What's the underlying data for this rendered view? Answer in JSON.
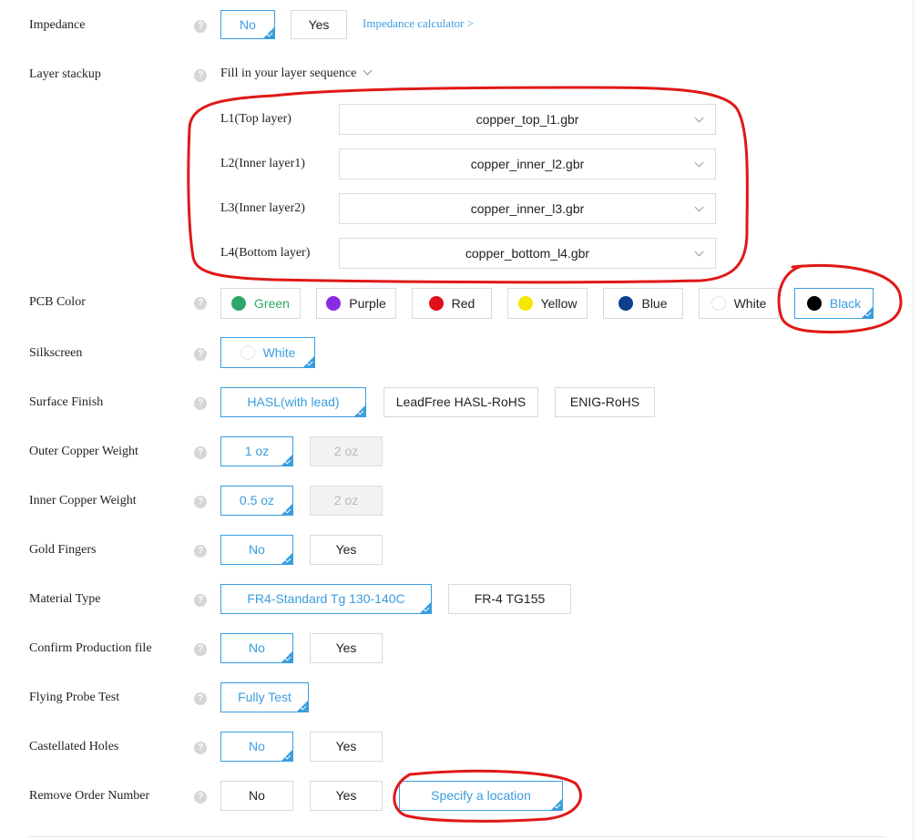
{
  "impedance": {
    "label": "Impedance",
    "options": [
      "No",
      "Yes"
    ],
    "calculator_link": "Impedance calculator >"
  },
  "layer_stackup": {
    "label": "Layer stackup",
    "toggle": "Fill in your layer sequence",
    "layers": [
      {
        "name": "L1(Top layer)",
        "file": "copper_top_l1.gbr"
      },
      {
        "name": "L2(Inner layer1)",
        "file": "copper_inner_l2.gbr"
      },
      {
        "name": "L3(Inner layer2)",
        "file": "copper_inner_l3.gbr"
      },
      {
        "name": "L4(Bottom layer)",
        "file": "copper_bottom_l4.gbr"
      }
    ]
  },
  "pcb_color": {
    "label": "PCB Color",
    "options": [
      {
        "name": "Green",
        "color": "#2ea66a"
      },
      {
        "name": "Purple",
        "color": "#8a2be2"
      },
      {
        "name": "Red",
        "color": "#e0101a"
      },
      {
        "name": "Yellow",
        "color": "#f5e600"
      },
      {
        "name": "Blue",
        "color": "#0d3f8f"
      },
      {
        "name": "White",
        "color": "#ffffff"
      },
      {
        "name": "Black",
        "color": "#000000"
      }
    ],
    "selected": "Black"
  },
  "silkscreen": {
    "label": "Silkscreen",
    "options": [
      "White"
    ],
    "selected": "White"
  },
  "surface_finish": {
    "label": "Surface Finish",
    "options": [
      "HASL(with lead)",
      "LeadFree HASL-RoHS",
      "ENIG-RoHS"
    ],
    "selected": "HASL(with lead)"
  },
  "outer_copper": {
    "label": "Outer Copper Weight",
    "options": [
      "1 oz",
      "2 oz"
    ],
    "selected": "1 oz"
  },
  "inner_copper": {
    "label": "Inner Copper Weight",
    "options": [
      "0.5 oz",
      "2 oz"
    ],
    "selected": "0.5 oz"
  },
  "gold_fingers": {
    "label": "Gold Fingers",
    "options": [
      "No",
      "Yes"
    ],
    "selected": "No"
  },
  "material_type": {
    "label": "Material Type",
    "options": [
      "FR4-Standard Tg 130-140C",
      "FR-4 TG155"
    ],
    "selected": "FR4-Standard Tg 130-140C"
  },
  "confirm_production": {
    "label": "Confirm Production file",
    "options": [
      "No",
      "Yes"
    ],
    "selected": "No"
  },
  "flying_probe": {
    "label": "Flying Probe Test",
    "options": [
      "Fully Test"
    ],
    "selected": "Fully Test"
  },
  "castellated": {
    "label": "Castellated Holes",
    "options": [
      "No",
      "Yes"
    ],
    "selected": "No"
  },
  "remove_order": {
    "label": "Remove Order Number",
    "options": [
      "No",
      "Yes",
      "Specify a location"
    ],
    "selected": "Specify a location"
  },
  "help_glyph": "?",
  "colors": {
    "accent": "#3a9de0",
    "annotation": "#e01818"
  }
}
